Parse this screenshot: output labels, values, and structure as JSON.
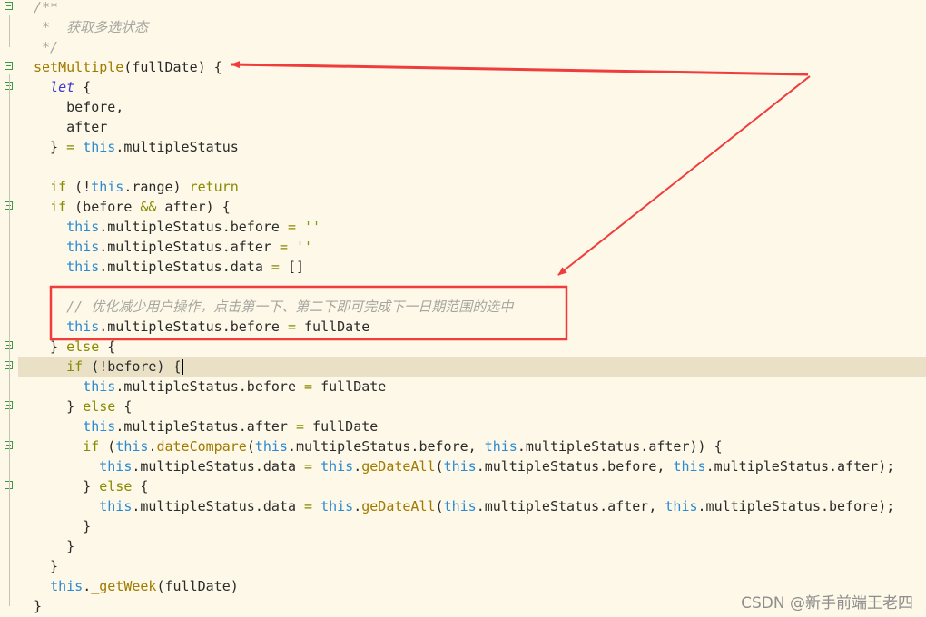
{
  "editor": {
    "current_line": 18,
    "fold_lines": [
      0,
      3,
      4,
      10,
      17,
      18,
      20,
      22,
      24
    ],
    "lines": [
      [
        [
          "c",
          "/**"
        ]
      ],
      [
        [
          "c",
          " *  获取多选状态"
        ]
      ],
      [
        [
          "c",
          " */"
        ]
      ],
      [
        [
          "f",
          "setMultiple"
        ],
        [
          "p",
          "(fullDate) {"
        ]
      ],
      [
        [
          "p",
          "  "
        ],
        [
          "l",
          "let"
        ],
        [
          "p",
          " {"
        ]
      ],
      [
        [
          "p",
          "    before,"
        ]
      ],
      [
        [
          "p",
          "    after"
        ]
      ],
      [
        [
          "p",
          "  } "
        ],
        [
          "o",
          "="
        ],
        [
          "p",
          " "
        ],
        [
          "t",
          "this"
        ],
        [
          "p",
          ".multipleStatus"
        ]
      ],
      [],
      [
        [
          "p",
          "  "
        ],
        [
          "k",
          "if"
        ],
        [
          "p",
          " (!"
        ],
        [
          "t",
          "this"
        ],
        [
          "p",
          ".range) "
        ],
        [
          "k",
          "return"
        ]
      ],
      [
        [
          "p",
          "  "
        ],
        [
          "k",
          "if"
        ],
        [
          "p",
          " (before "
        ],
        [
          "o",
          "&&"
        ],
        [
          "p",
          " after) {"
        ]
      ],
      [
        [
          "p",
          "    "
        ],
        [
          "t",
          "this"
        ],
        [
          "p",
          ".multipleStatus.before "
        ],
        [
          "o",
          "="
        ],
        [
          "p",
          " "
        ],
        [
          "s",
          "''"
        ]
      ],
      [
        [
          "p",
          "    "
        ],
        [
          "t",
          "this"
        ],
        [
          "p",
          ".multipleStatus.after "
        ],
        [
          "o",
          "="
        ],
        [
          "p",
          " "
        ],
        [
          "s",
          "''"
        ]
      ],
      [
        [
          "p",
          "    "
        ],
        [
          "t",
          "this"
        ],
        [
          "p",
          ".multipleStatus.data "
        ],
        [
          "o",
          "="
        ],
        [
          "p",
          " []"
        ]
      ],
      [],
      [
        [
          "p",
          "    "
        ],
        [
          "c",
          "// 优化减少用户操作，点击第一下、第二下即可完成下一日期范围的选中"
        ]
      ],
      [
        [
          "p",
          "    "
        ],
        [
          "t",
          "this"
        ],
        [
          "p",
          ".multipleStatus.before "
        ],
        [
          "o",
          "="
        ],
        [
          "p",
          " fullDate"
        ]
      ],
      [
        [
          "p",
          "  } "
        ],
        [
          "k",
          "else"
        ],
        [
          "p",
          " {"
        ]
      ],
      [
        [
          "p",
          "    "
        ],
        [
          "k",
          "if"
        ],
        [
          "p",
          " (!before) {"
        ]
      ],
      [
        [
          "p",
          "      "
        ],
        [
          "t",
          "this"
        ],
        [
          "p",
          ".multipleStatus.before "
        ],
        [
          "o",
          "="
        ],
        [
          "p",
          " fullDate"
        ]
      ],
      [
        [
          "p",
          "    } "
        ],
        [
          "k",
          "else"
        ],
        [
          "p",
          " {"
        ]
      ],
      [
        [
          "p",
          "      "
        ],
        [
          "t",
          "this"
        ],
        [
          "p",
          ".multipleStatus.after "
        ],
        [
          "o",
          "="
        ],
        [
          "p",
          " fullDate"
        ]
      ],
      [
        [
          "p",
          "      "
        ],
        [
          "k",
          "if"
        ],
        [
          "p",
          " ("
        ],
        [
          "t",
          "this"
        ],
        [
          "p",
          "."
        ],
        [
          "f",
          "dateCompare"
        ],
        [
          "p",
          "("
        ],
        [
          "t",
          "this"
        ],
        [
          "p",
          ".multipleStatus.before, "
        ],
        [
          "t",
          "this"
        ],
        [
          "p",
          ".multipleStatus.after)) {"
        ]
      ],
      [
        [
          "p",
          "        "
        ],
        [
          "t",
          "this"
        ],
        [
          "p",
          ".multipleStatus.data "
        ],
        [
          "o",
          "="
        ],
        [
          "p",
          " "
        ],
        [
          "t",
          "this"
        ],
        [
          "p",
          "."
        ],
        [
          "f",
          "geDateAll"
        ],
        [
          "p",
          "("
        ],
        [
          "t",
          "this"
        ],
        [
          "p",
          ".multipleStatus.before, "
        ],
        [
          "t",
          "this"
        ],
        [
          "p",
          ".multipleStatus.after);"
        ]
      ],
      [
        [
          "p",
          "      } "
        ],
        [
          "k",
          "else"
        ],
        [
          "p",
          " {"
        ]
      ],
      [
        [
          "p",
          "        "
        ],
        [
          "t",
          "this"
        ],
        [
          "p",
          ".multipleStatus.data "
        ],
        [
          "o",
          "="
        ],
        [
          "p",
          " "
        ],
        [
          "t",
          "this"
        ],
        [
          "p",
          "."
        ],
        [
          "f",
          "geDateAll"
        ],
        [
          "p",
          "("
        ],
        [
          "t",
          "this"
        ],
        [
          "p",
          ".multipleStatus.after, "
        ],
        [
          "t",
          "this"
        ],
        [
          "p",
          ".multipleStatus.before);"
        ]
      ],
      [
        [
          "p",
          "      }"
        ]
      ],
      [
        [
          "p",
          "    }"
        ]
      ],
      [
        [
          "p",
          "  }"
        ]
      ],
      [
        [
          "p",
          "  "
        ],
        [
          "t",
          "this"
        ],
        [
          "p",
          "."
        ],
        [
          "f",
          "_getWeek"
        ],
        [
          "p",
          "(fullDate)"
        ]
      ],
      [
        [
          "p",
          "}"
        ]
      ]
    ]
  },
  "annotation_color": "#f03c3c",
  "watermark": "CSDN @新手前端王老四"
}
